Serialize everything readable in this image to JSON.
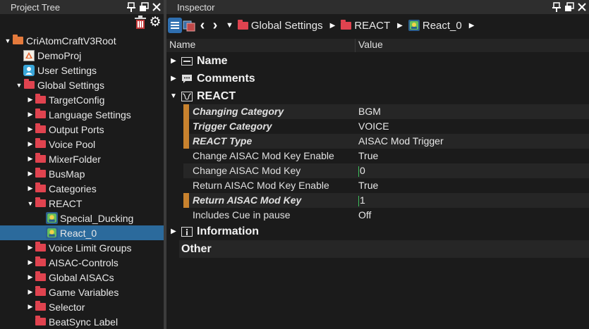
{
  "project_tree": {
    "title": "Project Tree",
    "items": [
      {
        "label": "CriAtomCraftV3Root",
        "indent": 0,
        "expanded": true,
        "icon": "folder-orange-icon"
      },
      {
        "label": "DemoProj",
        "indent": 1,
        "icon": "project-icon"
      },
      {
        "label": "User Settings",
        "indent": 1,
        "icon": "user-icon"
      },
      {
        "label": "Global Settings",
        "indent": 1,
        "expanded": true,
        "icon": "folder-icon"
      },
      {
        "label": "TargetConfig",
        "indent": 2,
        "collapsed": true,
        "icon": "folder-icon"
      },
      {
        "label": "Language Settings",
        "indent": 2,
        "collapsed": true,
        "icon": "folder-icon"
      },
      {
        "label": "Output Ports",
        "indent": 2,
        "collapsed": true,
        "icon": "folder-icon"
      },
      {
        "label": "Voice Pool",
        "indent": 2,
        "collapsed": true,
        "icon": "folder-icon"
      },
      {
        "label": "MixerFolder",
        "indent": 2,
        "collapsed": true,
        "icon": "folder-icon"
      },
      {
        "label": "BusMap",
        "indent": 2,
        "collapsed": true,
        "icon": "folder-icon"
      },
      {
        "label": "Categories",
        "indent": 2,
        "collapsed": true,
        "icon": "folder-icon"
      },
      {
        "label": "REACT",
        "indent": 2,
        "expanded": true,
        "icon": "folder-icon"
      },
      {
        "label": "Special_Ducking",
        "indent": 3,
        "icon": "react-icon"
      },
      {
        "label": "React_0",
        "indent": 3,
        "icon": "react-icon",
        "selected": true
      },
      {
        "label": "Voice Limit Groups",
        "indent": 2,
        "collapsed": true,
        "icon": "folder-icon"
      },
      {
        "label": "AISAC-Controls",
        "indent": 2,
        "collapsed": true,
        "icon": "folder-icon"
      },
      {
        "label": "Global AISACs",
        "indent": 2,
        "collapsed": true,
        "icon": "folder-icon"
      },
      {
        "label": "Game Variables",
        "indent": 2,
        "collapsed": true,
        "icon": "folder-icon"
      },
      {
        "label": "Selector",
        "indent": 2,
        "collapsed": true,
        "icon": "folder-icon"
      },
      {
        "label": "BeatSync Label",
        "indent": 2,
        "icon": "folder-icon"
      }
    ]
  },
  "inspector": {
    "title": "Inspector",
    "breadcrumb": [
      "Global Settings",
      "REACT",
      "React_0"
    ],
    "columns": {
      "name": "Name",
      "value": "Value"
    },
    "categories": {
      "name": "Name",
      "comments": "Comments",
      "react": "REACT",
      "information": "Information",
      "other": "Other"
    },
    "properties": [
      {
        "name": "Changing Category",
        "value": "BGM",
        "modified": true
      },
      {
        "name": "Trigger Category",
        "value": "VOICE",
        "modified": true
      },
      {
        "name": "REACT Type",
        "value": "AISAC Mod Trigger",
        "modified": true
      },
      {
        "name": "Change AISAC Mod Key Enable",
        "value": "True",
        "modified": false
      },
      {
        "name": "Change AISAC Mod Key",
        "value": "0",
        "modified": false,
        "editing": true
      },
      {
        "name": "Return AISAC Mod Key Enable",
        "value": "True",
        "modified": false
      },
      {
        "name": "Return AISAC Mod Key",
        "value": "1",
        "modified": true,
        "editing": true
      },
      {
        "name": "Includes Cue in pause",
        "value": "Off",
        "modified": false
      }
    ]
  },
  "colors": {
    "selection": "#2b6a9c",
    "folder": "#e0434f",
    "root_folder": "#e47a3c",
    "modified_marker": "#c8822e",
    "accent_button": "#2f6fb0"
  }
}
